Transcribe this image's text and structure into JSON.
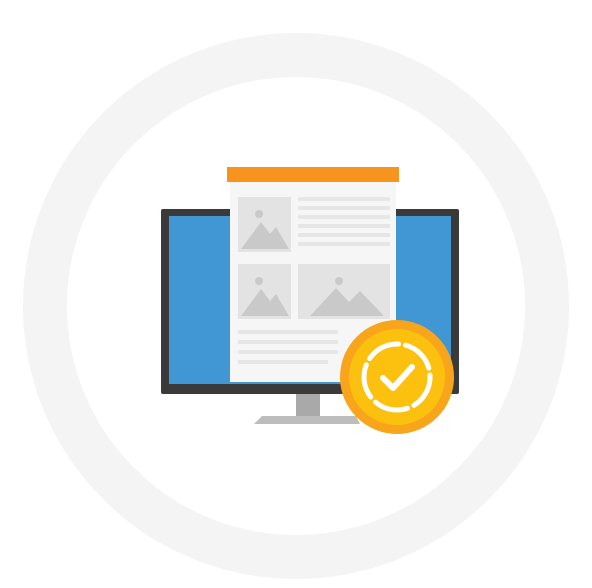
{
  "illustration": {
    "subject": "monitor-with-web-page-and-check-badge",
    "icons": [
      "monitor-icon",
      "web-page-icon",
      "image-placeholder-icon",
      "check-badge-icon"
    ]
  },
  "colors": {
    "background": "#ffffff",
    "ring": "#f4f4f4",
    "monitor_frame": "#3a3a3a",
    "monitor_screen": "#4196d4",
    "monitor_stand": "#a9a9a9",
    "monitor_base": "#bdbdbd",
    "page_header": "#f7941e",
    "page_body": "#f6f6f6",
    "page_placeholder": "#e3e3e3",
    "page_placeholder_shape": "#c9c9c9",
    "page_text_line": "#e6e6e6",
    "badge_outer": "#f9a51b",
    "badge_inner": "#fcc10f",
    "badge_mark": "#ffffff"
  }
}
